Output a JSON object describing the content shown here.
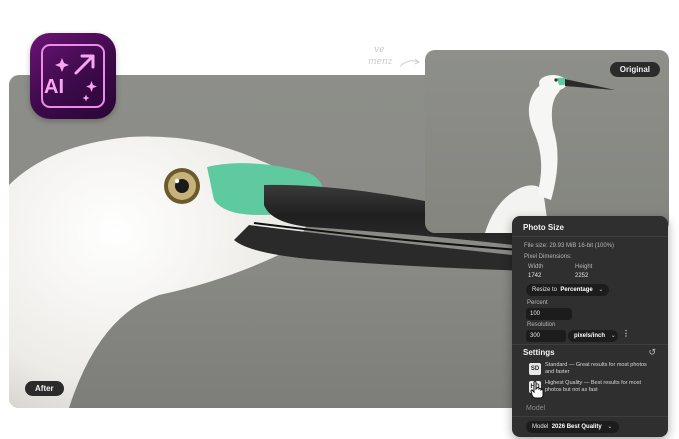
{
  "app_icon": {
    "label": "AI",
    "icon": "sparkle-upscale-icon"
  },
  "scribble": {
    "line1": "ve",
    "line2": "menz"
  },
  "after_image": {
    "badge": "After"
  },
  "original_image": {
    "badge": "Original"
  },
  "photo_size": {
    "title": "Photo Size",
    "file_size": "File size: 29.93 MiB 16-bit (100%)",
    "pixel_dimensions_label": "Pixel Dimensions:",
    "width_label": "Width",
    "height_label": "Height",
    "width_value": "1742",
    "height_value": "2252",
    "resize_label": "Resize to",
    "resize_value": "Percentage",
    "percent_label": "Percent",
    "percent_value": "100",
    "resolution_label": "Resolution",
    "resolution_value": "300",
    "resolution_unit": "pixels/inch",
    "more_label": "⋮"
  },
  "settings": {
    "title": "Settings",
    "reset_icon": "↺",
    "options": [
      {
        "badge": "SD",
        "text": "Standard — Great results for most photos and faster"
      },
      {
        "badge": "HQ",
        "text": "Highest Quality — Best results for most photos but not as fast"
      }
    ],
    "model_heading": "Model",
    "model_label": "Model",
    "model_value": "2026 Best Quality"
  },
  "colors": {
    "accent": "#f08ae8",
    "bird_mask": "#5fc9a0",
    "panel_bg": "#2f2f2f"
  }
}
